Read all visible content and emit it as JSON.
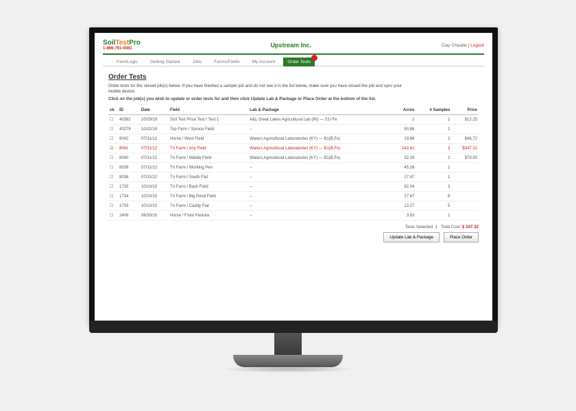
{
  "header": {
    "logo_text": "SoilTestPro",
    "phone": "1-866-761-0081",
    "org": "Upstream Inc.",
    "user": "Clay Cheatle",
    "logout": "Logout"
  },
  "tabs": {
    "items": [
      {
        "label": "FarmLogic"
      },
      {
        "label": "Getting Started"
      },
      {
        "label": "Jobs"
      },
      {
        "label": "Farms/Fields"
      },
      {
        "label": "My Account"
      },
      {
        "label": "Order Tests",
        "active": true,
        "badge": ""
      }
    ]
  },
  "page": {
    "title": "Order Tests",
    "intro": "Order tests for the closed job(s) below. If you have finished a sample job and do not see it in the list below, make sure you have closed the job and sync your mobile device.",
    "instruction": "Click on the job(s) you wish to update or order tests for and then click Update Lab & Package or Place Order at the bottom of the list."
  },
  "columns": {
    "ck": "ck",
    "id": "ID",
    "date": "Date",
    "field": "Field",
    "lab": "Lab & Package",
    "acres": "Acres",
    "samples": "# Samples",
    "price": "Price"
  },
  "rows": [
    {
      "ck": "☐",
      "id": "40392",
      "date": "10/29/19",
      "field": "Soil Test Price Test / Test 1",
      "lab": "A&L Great Lakes Agricultural Lab (IN) — S1+Fe",
      "acres": "1",
      "samples": "1",
      "price": "$12.25"
    },
    {
      "ck": "☐",
      "id": "40278",
      "date": "10/22/19",
      "field": "Top Farm / Spruce Field",
      "lab": "--",
      "acres": "50.86",
      "samples": "2",
      "price": ""
    },
    {
      "ck": "☐",
      "id": "8042",
      "date": "07/31/12",
      "field": "Horse / West Field",
      "lab": "Waters Agricultural Laboratories (KY) — B1(B,Fe)",
      "acres": "19.86",
      "samples": "2",
      "price": "$46.72"
    },
    {
      "ck": "☑",
      "id": "8041",
      "date": "07/31/12",
      "field": "Tn Farm / Any Field",
      "lab": "Waters Agricultural Laboratories (KY) — B1(B,Fe)",
      "acres": "142.41",
      "samples": "3",
      "price": "$347.32",
      "selected": true
    },
    {
      "ck": "☐",
      "id": "8040",
      "date": "07/31/12",
      "field": "Tn Farm / Middle Field",
      "lab": "Waters Agricultural Laboratories (KY) — B1(B,Fe)",
      "acres": "32.29",
      "samples": "2",
      "price": "$79.50"
    },
    {
      "ck": "☐",
      "id": "8039",
      "date": "07/31/12",
      "field": "Tn Farm / Working Pen",
      "lab": "--",
      "acres": "45.26",
      "samples": "2",
      "price": ""
    },
    {
      "ck": "☐",
      "id": "8038",
      "date": "07/31/12",
      "field": "Tn Farm / South Flat",
      "lab": "--",
      "acres": "27.47",
      "samples": "1",
      "price": ""
    },
    {
      "ck": "☐",
      "id": "1735",
      "date": "10/10/10",
      "field": "Tn Farm / Back Field",
      "lab": "--",
      "acres": "82.04",
      "samples": "3",
      "price": ""
    },
    {
      "ck": "☐",
      "id": "1734",
      "date": "10/10/10",
      "field": "Tn Farm / Big Pond Field",
      "lab": "--",
      "acres": "37.67",
      "samples": "6",
      "price": ""
    },
    {
      "ck": "☐",
      "id": "1733",
      "date": "10/10/10",
      "field": "Tn Farm / Caddy Flat",
      "lab": "--",
      "acres": "13.27",
      "samples": "5",
      "price": ""
    },
    {
      "ck": "☐",
      "id": "2406",
      "date": "08/30/10",
      "field": "Horse / Front Pasture",
      "lab": "--",
      "acres": "3.93",
      "samples": "1",
      "price": ""
    }
  ],
  "footer": {
    "selected_label": "Tests Selected:",
    "selected_count": "1",
    "total_label": "Total Cost:",
    "total_amount": "$ 347.32",
    "btn_update": "Update Lab & Package",
    "btn_place": "Place Order"
  }
}
